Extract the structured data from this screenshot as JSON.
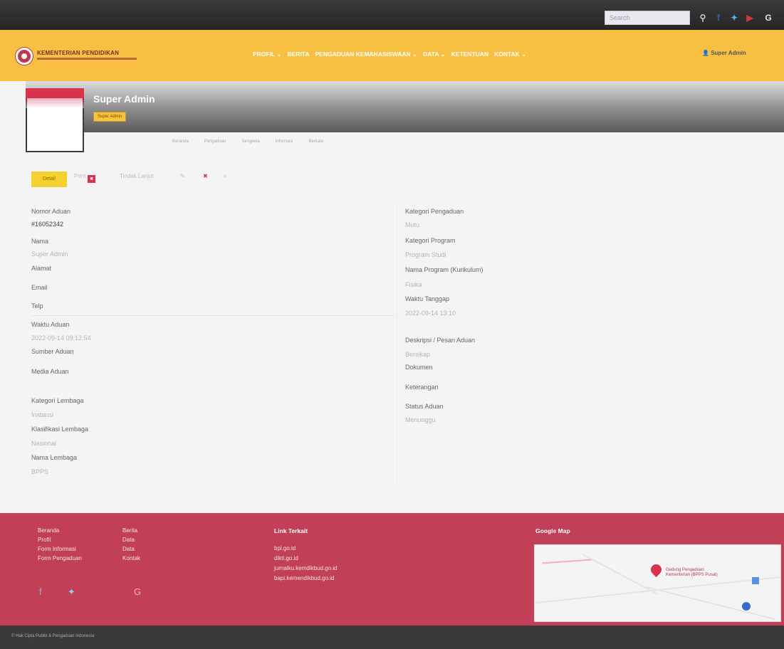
{
  "topbar": {
    "search_placeholder": "Search",
    "icons": [
      "search-icon",
      "facebook-icon",
      "twitter-icon",
      "youtube-icon",
      "google-icon"
    ]
  },
  "nav": {
    "logo_text": "KEMENTERIAN PENDIDIKAN",
    "menu": [
      "PROFIL ⌄",
      "BERITA",
      "PENGADUAN KEMAHASISWAAN ⌄",
      "DATA ⌄",
      "KETENTUAN",
      "KONTAK ⌄"
    ],
    "login_label": "Super Admin"
  },
  "profile": {
    "name": "Super Admin",
    "role_badge": "Super Admin",
    "tabs": [
      "Beranda",
      "Pengaduan",
      "Sengketa",
      "Informasi",
      "Berkala"
    ]
  },
  "actions": {
    "primary": "Detail",
    "print": "Print",
    "secondary": "Tindak Lanjut",
    "icons": [
      "edit-icon",
      "delete-icon",
      "close-icon"
    ]
  },
  "left_details": [
    {
      "label": "Nomor Aduan",
      "value": "#16052342"
    },
    {
      "label": "Nama",
      "value": "Super Admin"
    },
    {
      "label": "Alamat",
      "value": ""
    },
    {
      "label": "Email",
      "value": ""
    },
    {
      "label": "Telp",
      "value": ""
    },
    {
      "label": "Waktu Aduan",
      "value": "2022-09-14 09:12:54"
    },
    {
      "label": "Sumber Aduan",
      "value": ""
    },
    {
      "label": "Media Aduan",
      "value": ""
    },
    {
      "label": "Kategori Lembaga",
      "value": "Instansi"
    },
    {
      "label": "Klasifikasi Lembaga",
      "value": "Nasional"
    },
    {
      "label": "Nama Lembaga",
      "value": "BPPS"
    }
  ],
  "right_details": [
    {
      "label": "Kategori Pengaduan",
      "value": "Mutu"
    },
    {
      "label": "Kategori Program",
      "value": "Program Studi"
    },
    {
      "label": "Nama Program (Kurikulum)",
      "value": "Fisika"
    },
    {
      "label": "Waktu Tanggap",
      "value": "2022-09-14 13:10"
    },
    {
      "label": "Deskripsi / Pesan Aduan",
      "value": "Bersikap"
    },
    {
      "label": "Dokumen",
      "value": ""
    },
    {
      "label": "Keterangan",
      "value": ""
    },
    {
      "label": "Status Aduan",
      "value": "Menunggu"
    }
  ],
  "footer": {
    "col1": [
      "Beranda",
      "Profil",
      "Form Informasi",
      "Form Pengaduan"
    ],
    "col2": [
      "Berita",
      "Data",
      "Data",
      "Kontak"
    ],
    "links_heading": "Link Terkait",
    "links": [
      "bpi.go.id",
      "dikti.go.id",
      "jurnalku.kemdikbud.go.id",
      "bapi.kemendikbud.go.id"
    ],
    "map_heading": "Google Map",
    "map_place": "Gedung Pengaduan Kementerian (BPPS Pusat)",
    "social_icons": [
      "facebook-icon",
      "twitter-icon",
      "google-icon"
    ],
    "copyright": "© Hak Cipta Publik & Pengaduan Indonesia"
  },
  "colors": {
    "accent_yellow": "#f8c042",
    "accent_red": "#c14057",
    "dark": "#2f2f2f"
  }
}
